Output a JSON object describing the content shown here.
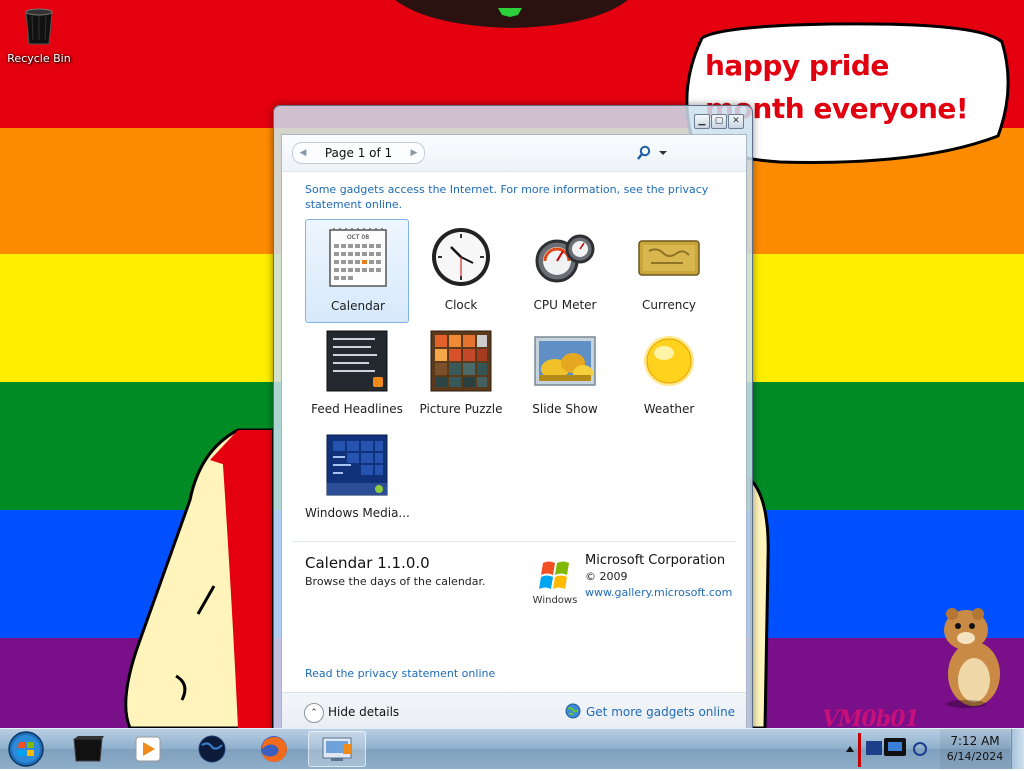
{
  "desktop": {
    "stripe_colors": [
      "#e4000e",
      "#ff8c00",
      "#ffee00",
      "#008b25",
      "#0050ff",
      "#7a0f8a"
    ],
    "recycle_bin_label": "Recycle Bin",
    "speech_text": "happy pride month everyone!",
    "speech_color": "#e00010",
    "watermark": "VM0b01"
  },
  "gadget_window": {
    "pager_text": "Page 1 of 1",
    "info_text": "Some gadgets access the Internet.  For more information, see the privacy statement online.",
    "gadgets": [
      {
        "label": "Calendar",
        "icon": "calendar-icon",
        "selected": true
      },
      {
        "label": "Clock",
        "icon": "clock-icon"
      },
      {
        "label": "CPU Meter",
        "icon": "cpu-meter-icon"
      },
      {
        "label": "Currency",
        "icon": "currency-icon"
      },
      {
        "label": "Feed Headlines",
        "icon": "feed-headlines-icon"
      },
      {
        "label": "Picture Puzzle",
        "icon": "picture-puzzle-icon"
      },
      {
        "label": "Slide Show",
        "icon": "slide-show-icon"
      },
      {
        "label": "Weather",
        "icon": "weather-icon"
      },
      {
        "label": "Windows Media...",
        "icon": "windows-media-icon"
      }
    ],
    "calendar_icon_month": "OCT 08",
    "details": {
      "title": "Calendar 1.1.0.0",
      "description": "Browse the days of the calendar.",
      "publisher": "Microsoft Corporation",
      "year": "© 2009",
      "url": "www.gallery.microsoft.com",
      "logo_text": "Windows"
    },
    "privacy_link": "Read the privacy statement online",
    "hide_details": "Hide details",
    "get_more": "Get more gadgets online"
  },
  "taskbar": {
    "items": [
      "command-prompt-icon",
      "media-player-icon",
      "globe-app-icon",
      "firefox-icon",
      "gadgets-window-icon"
    ],
    "time": "7:12 AM",
    "date": "6/14/2024"
  }
}
